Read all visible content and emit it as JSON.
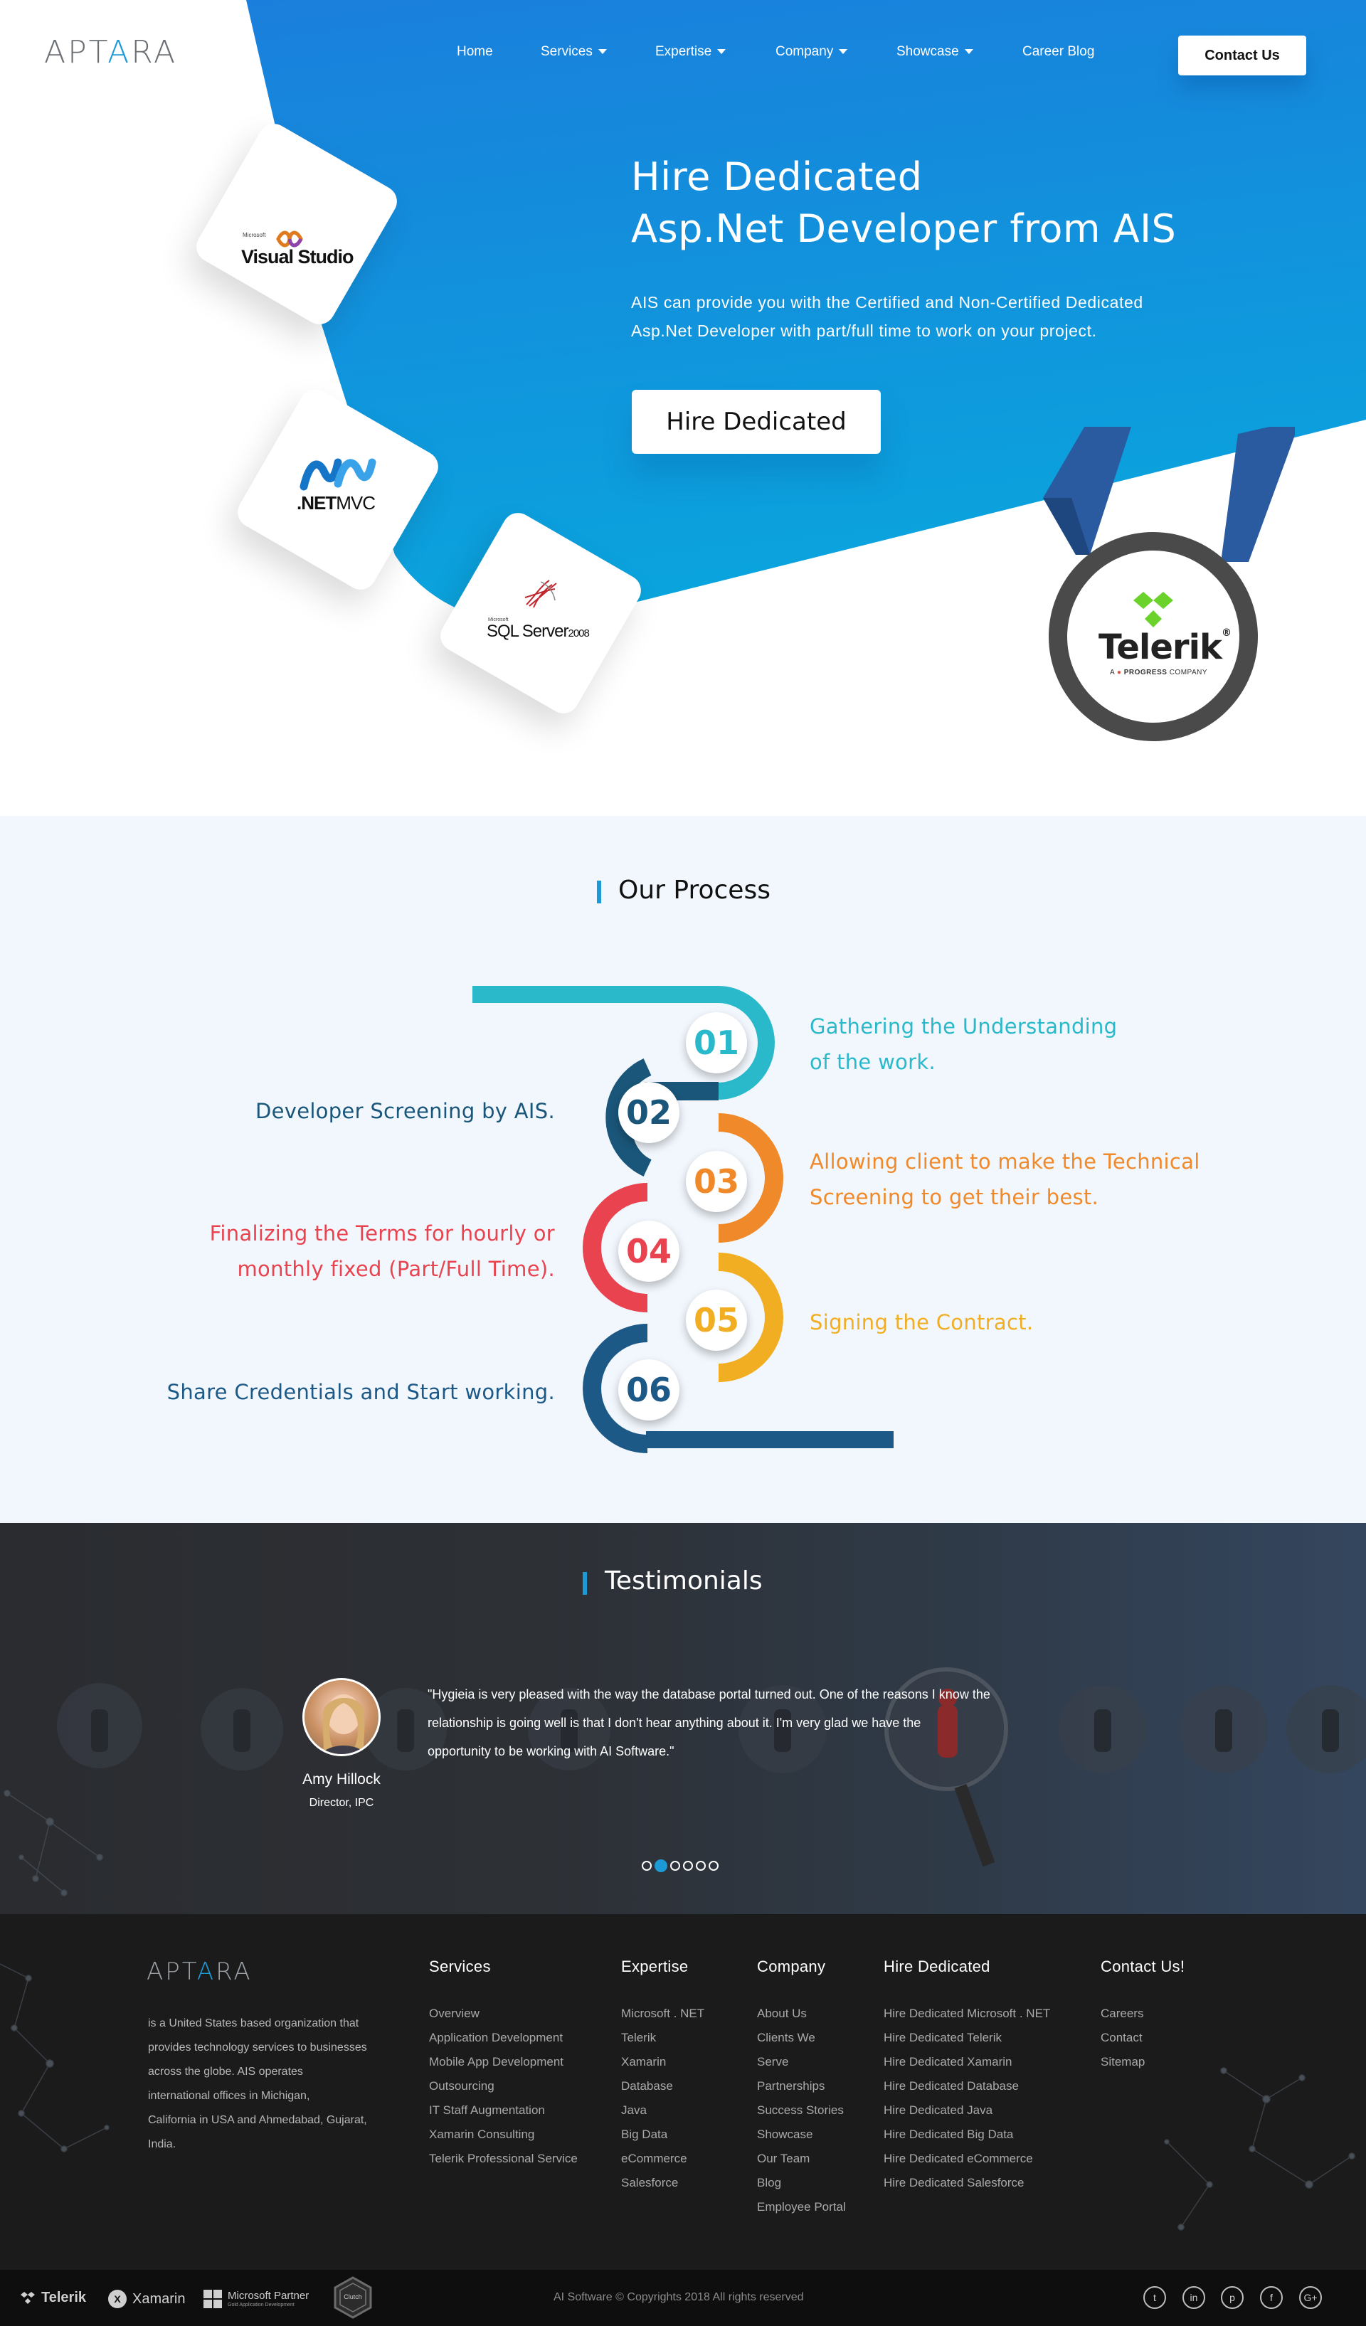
{
  "brand": {
    "name_left": "APT",
    "name_accent": "A",
    "name_right": "RA"
  },
  "nav": {
    "items": [
      {
        "label": "Home",
        "has_dropdown": false
      },
      {
        "label": "Services",
        "has_dropdown": true
      },
      {
        "label": "Expertise",
        "has_dropdown": true
      },
      {
        "label": "Company",
        "has_dropdown": true
      },
      {
        "label": "Showcase",
        "has_dropdown": true
      },
      {
        "label": "Career Blog",
        "has_dropdown": false
      }
    ],
    "contact_label": "Contact Us"
  },
  "hero": {
    "title_line1": "Hire Dedicated",
    "title_line2": "Asp.Net Developer from AIS",
    "description_line1": "AIS can provide you with the Certified and Non-Certified Dedicated",
    "description_line2": "Asp.Net Developer with part/full time to work on your project.",
    "button_label": "Hire Dedicated",
    "tech_cards": [
      {
        "maker": "Microsoft",
        "name": "Visual Studio",
        "icon": "visual-studio-icon"
      },
      {
        "maker": ".NET",
        "name": "MVC",
        "icon": "dotnet-icon"
      },
      {
        "maker": "Microsoft",
        "name": "SQL Server",
        "suffix": "2008",
        "icon": "sql-server-icon"
      }
    ],
    "medal": {
      "brand": "Telerik",
      "reg": "®",
      "sub_a": "A",
      "sub_b": "PROGRESS",
      "sub_c": "COMPANY",
      "icon": "telerik-icon"
    },
    "colors": {
      "blue_start": "#1a7fdc",
      "blue_end": "#0ea6dd",
      "strap": "#27579a"
    }
  },
  "process": {
    "title": "Our Process",
    "steps": [
      {
        "num": "01",
        "text_line1": "Gathering the Understanding",
        "text_line2": "of the work.",
        "color": "#29b9cb"
      },
      {
        "num": "02",
        "text_line1": "Developer Screening by AIS.",
        "text_line2": "",
        "color": "#1a5679"
      },
      {
        "num": "03",
        "text_line1": "Allowing client to make the Technical",
        "text_line2": "Screening to get their best.",
        "color": "#f0892a"
      },
      {
        "num": "04",
        "text_line1": "Finalizing the Terms for hourly or",
        "text_line2": "monthly fixed (Part/Full Time).",
        "color": "#e9434f"
      },
      {
        "num": "05",
        "text_line1": "Signing the Contract.",
        "text_line2": "",
        "color": "#f2ae22"
      },
      {
        "num": "06",
        "text_line1": "Share Credentials and Start working.",
        "text_line2": "",
        "color": "#1d5987"
      }
    ]
  },
  "testimonials": {
    "title": "Testimonials",
    "name": "Amy Hillock",
    "role": "Director, IPC",
    "quote_line1": "\"Hygieia is very pleased with the way the database portal turned out. One of the reasons I know the",
    "quote_line2": "relationship is going well is that I don't hear anything about it. I'm very glad we have the",
    "quote_line3": "opportunity to be working with AI Software.\"",
    "dots_total": 6,
    "dots_active_index": 1
  },
  "footer": {
    "about_lines": [
      "is a United States based organization that",
      "provides technology services to businesses",
      "across the globe. AIS operates",
      "international offices in Michigan,",
      "California in USA and Ahmedabad, Gujarat,",
      "India."
    ],
    "columns": [
      {
        "heading": "Services",
        "links": [
          "Overview",
          "Application Development",
          "Mobile App Development",
          "Outsourcing",
          "IT Staff Augmentation",
          "Xamarin Consulting",
          "Telerik Professional Service"
        ]
      },
      {
        "heading": "Expertise",
        "links": [
          "Microsoft . NET",
          "Telerik",
          "Xamarin",
          "Database",
          "Java",
          "Big Data",
          "eCommerce",
          "Salesforce"
        ]
      },
      {
        "heading": "Company",
        "links": [
          "About Us",
          "Clients We",
          "Serve",
          "Partnerships",
          "Success Stories",
          "Showcase",
          "Our Team",
          "Blog",
          "Employee Portal"
        ]
      },
      {
        "heading": "Hire Dedicated",
        "links": [
          "Hire Dedicated Microsoft . NET",
          "Hire Dedicated Telerik",
          "Hire Dedicated Xamarin",
          "Hire Dedicated Database",
          "Hire Dedicated Java",
          "Hire Dedicated Big Data",
          "Hire Dedicated eCommerce",
          "Hire Dedicated Salesforce"
        ]
      },
      {
        "heading": "Contact Us!",
        "links": [
          "Careers",
          "Contact",
          "Sitemap"
        ]
      }
    ],
    "partners": [
      {
        "label": "Telerik",
        "icon": "telerik-icon"
      },
      {
        "label": "Xamarin",
        "icon": "xamarin-icon"
      },
      {
        "label": "Microsoft Partner",
        "sub": "Gold Application Development",
        "icon": "microsoft-icon"
      },
      {
        "label": "Clutch",
        "icon": "clutch-badge-icon"
      }
    ],
    "copyright": "AI Software © Copyrights 2018 All rights reserved",
    "social": [
      {
        "icon": "twitter-icon",
        "glyph": "t"
      },
      {
        "icon": "linkedin-icon",
        "glyph": "in"
      },
      {
        "icon": "pinterest-icon",
        "glyph": "p"
      },
      {
        "icon": "facebook-icon",
        "glyph": "f"
      },
      {
        "icon": "google-plus-icon",
        "glyph": "G+"
      }
    ]
  }
}
